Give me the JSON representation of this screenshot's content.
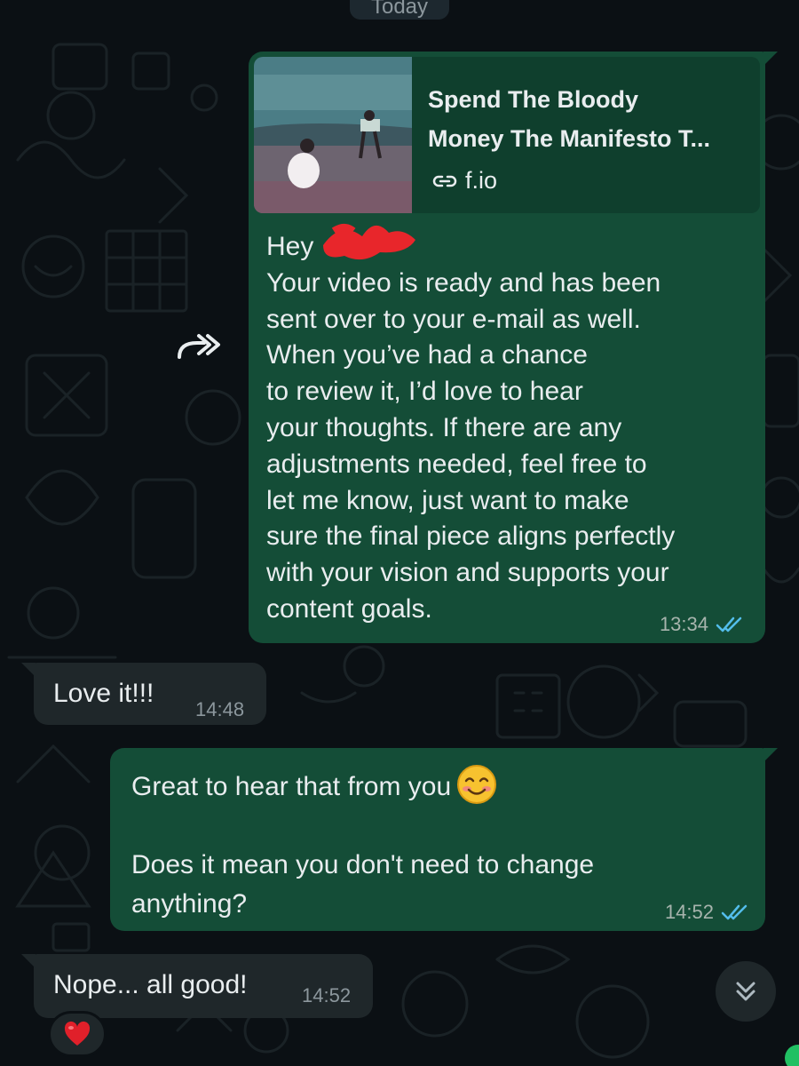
{
  "date_label": "Today",
  "colors": {
    "background": "#0b1014",
    "outgoing_bubble": "#144d37",
    "incoming_bubble": "#1f272a",
    "read_tick": "#53bdeb",
    "text": "#e9edef"
  },
  "messages": [
    {
      "direction": "outgoing",
      "forwarded_icon": "forward-icon",
      "link_preview": {
        "title": "Spend The Bloody\nMoney The Manifesto T...",
        "domain": "f.io",
        "link_icon": "link-icon"
      },
      "text": "Hey\nYour video is ready and has been\nsent over to your e-mail as well.\nWhen you’ve had a chance\nto review it, I’d love to hear\nyour thoughts. If there are any\nadjustments needed, feel free to\nlet me know, just want to make\nsure the final piece aligns perfectly\nwith your vision and supports your\ncontent goals.",
      "time": "13:34",
      "status_icon": "double-check-read-icon"
    },
    {
      "direction": "incoming",
      "text": "Love it!!!",
      "time": "14:48"
    },
    {
      "direction": "outgoing",
      "text_line1": "Great to hear that from you",
      "emoji": "smiling-face-emoji",
      "text_line2": "Does it mean you don't need to change anything?",
      "time": "14:52",
      "status_icon": "double-check-read-icon"
    },
    {
      "direction": "incoming",
      "text": "Nope... all good!",
      "time": "14:52",
      "reaction": "red-heart-emoji"
    }
  ],
  "scroll_button_icon": "double-chevron-down-icon"
}
